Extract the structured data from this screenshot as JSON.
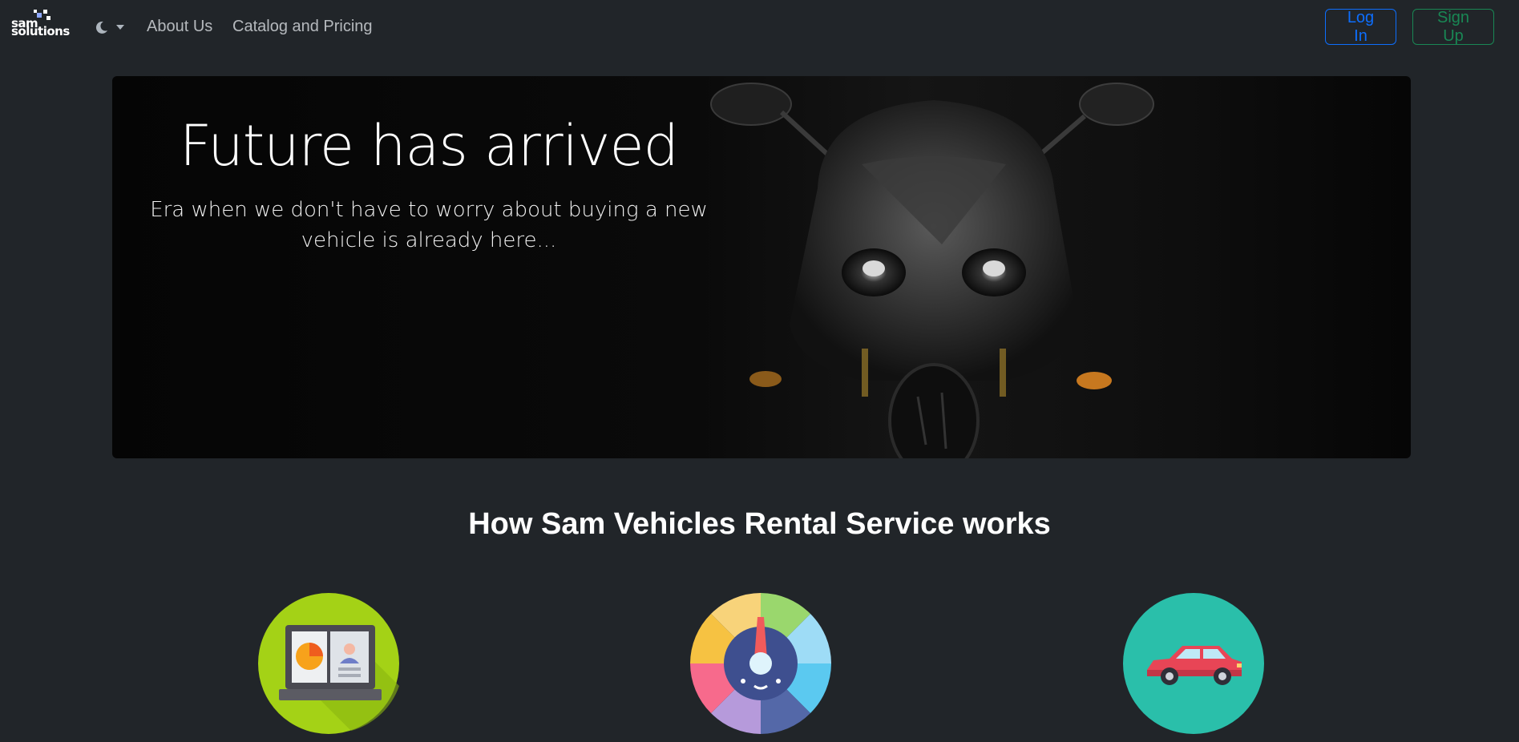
{
  "nav": {
    "logo_text_1": "sam",
    "logo_text_2": "solutions",
    "links": [
      "About Us",
      "Catalog and Pricing"
    ],
    "login_label": "Log In",
    "signup_label": "Sign Up"
  },
  "hero": {
    "title": "Future has arrived",
    "subtitle": "Era when we don't have to worry about buying a new vehicle is already here..."
  },
  "section": {
    "title": "How Sam Vehicles Rental Service works"
  },
  "colors": {
    "background": "#212529",
    "primary": "#0d6efd",
    "success": "#198754"
  },
  "icons": [
    "moon-icon",
    "caret-down-icon",
    "laptop-profile-icon",
    "speedometer-icon",
    "car-icon"
  ]
}
